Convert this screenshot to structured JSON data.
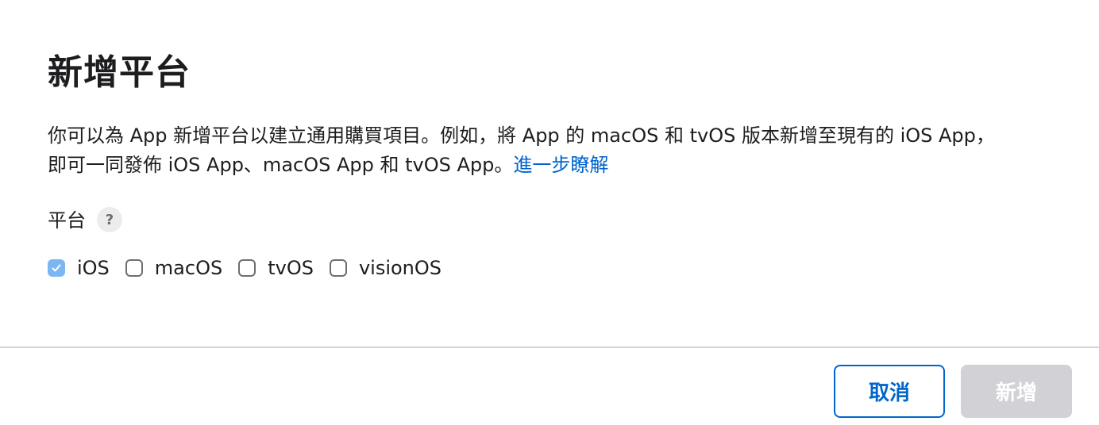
{
  "dialog": {
    "title": "新增平台",
    "description_text": "你可以為 App 新增平台以建立通用購買項目。例如，將 App 的 macOS 和 tvOS 版本新增至現有的 iOS App，即可一同發佈 iOS App、macOS App 和 tvOS App。",
    "learn_more_link": "進一步瞭解",
    "platform_section": {
      "label": "平台",
      "help_icon": "question-mark-icon",
      "help_glyph": "?",
      "options": [
        {
          "label": "iOS",
          "checked": true
        },
        {
          "label": "macOS",
          "checked": false
        },
        {
          "label": "tvOS",
          "checked": false
        },
        {
          "label": "visionOS",
          "checked": false
        }
      ]
    },
    "footer": {
      "cancel_label": "取消",
      "add_label": "新增",
      "add_enabled": false
    }
  },
  "colors": {
    "link": "#0066cc",
    "checkbox_checked": "#7cb7f2",
    "button_disabled_bg": "#d1d1d6",
    "divider": "#d2d2d7"
  }
}
